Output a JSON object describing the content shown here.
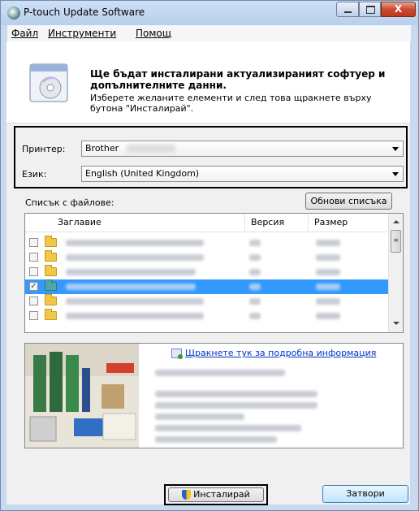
{
  "window": {
    "title": "P-touch Update Software",
    "close_glyph": "X"
  },
  "menu": {
    "file": "Файл",
    "tools": "Инструменти",
    "help": "Помощ"
  },
  "header": {
    "title": "Ще бъдат инсталирани актуализираният софтуер и допълнителните данни.",
    "description": "Изберете желаните елементи и след това щракнете върху бутона \"Инсталирай\"."
  },
  "printer": {
    "label": "Принтер:",
    "value": "Brother"
  },
  "language": {
    "label": "Език:",
    "value": "English (United Kingdom)"
  },
  "file_list": {
    "label": "Списък с файлове:",
    "refresh_button": "Обнови списъка",
    "columns": [
      "Заглавие",
      "Версия",
      "Размер"
    ],
    "rows": [
      {
        "checked": false,
        "selected": false
      },
      {
        "checked": false,
        "selected": false
      },
      {
        "checked": false,
        "selected": false
      },
      {
        "checked": true,
        "selected": true
      },
      {
        "checked": false,
        "selected": false
      },
      {
        "checked": false,
        "selected": false
      }
    ]
  },
  "info": {
    "link_text": "Щракнете тук за подробна информация"
  },
  "buttons": {
    "install": "Инсталирай",
    "close": "Затвори"
  },
  "colors": {
    "selection": "#3399ff",
    "link": "#0033cc"
  }
}
